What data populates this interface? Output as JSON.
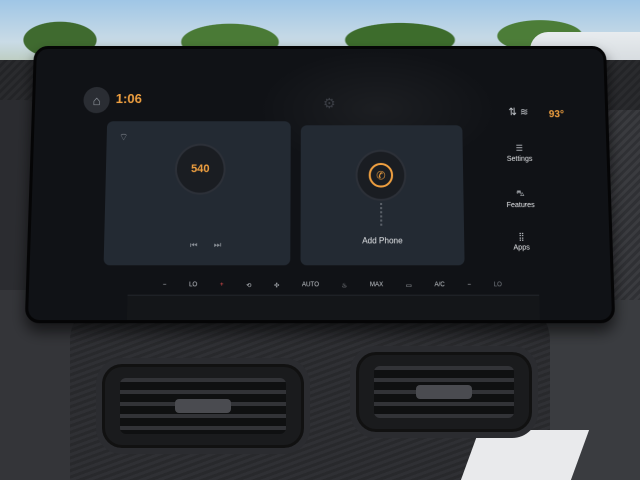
{
  "status": {
    "time": "1:06",
    "temperature": "93°",
    "home_icon": "home-icon",
    "center_icon": "sync-icon"
  },
  "radio": {
    "frequency": "540",
    "source_icon": "radio-signal-icon",
    "prev_icon": "previous-track-icon",
    "next_icon": "next-track-icon"
  },
  "phone": {
    "label": "Add Phone",
    "icon": "phone-icon"
  },
  "side_nav": {
    "settings": "Settings",
    "features": "Features",
    "apps": "Apps"
  },
  "climate": {
    "lo_left": "LO",
    "auto": "AUTO",
    "ac": "A/C",
    "max": "MAX",
    "lo_right": "LO"
  },
  "colors": {
    "accent": "#f0a040",
    "card": "#232a33",
    "screen": "#101216"
  }
}
